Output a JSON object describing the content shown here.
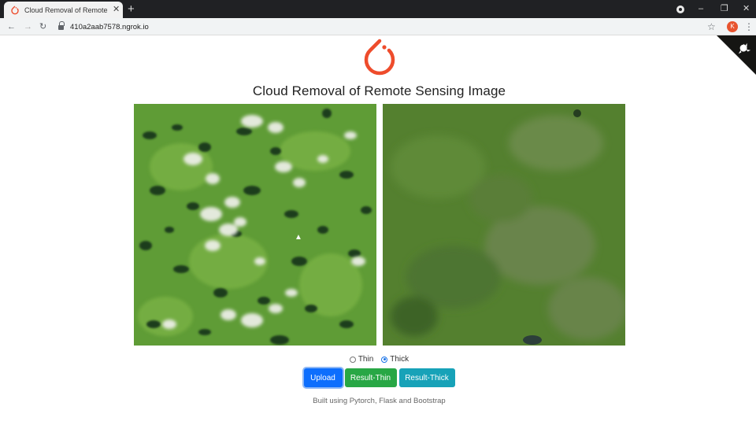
{
  "browser": {
    "tab_title": "Cloud Removal of Remote Se...",
    "tab_close_label": "✕",
    "new_tab_label": "+",
    "url": "410a2aab7578.ngrok.io",
    "profile_initial": "K",
    "nav": {
      "back": "←",
      "forward": "→",
      "reload": "↻"
    },
    "window": {
      "minimize": "–",
      "restore": "❐",
      "close": "✕"
    },
    "star_label": "☆",
    "menu_label": "⋮"
  },
  "page": {
    "title": "Cloud Removal of Remote Sensing Image",
    "icons": {
      "logo": "pytorch-logo-icon",
      "corner": "github-octocat-icon"
    },
    "images": {
      "input": "cloudy-satellite-image",
      "output": "cloud-free-satellite-image"
    },
    "mode": {
      "options": [
        {
          "label": "Thin",
          "selected": false
        },
        {
          "label": "Thick",
          "selected": true
        }
      ]
    },
    "buttons": {
      "upload": "Upload",
      "result_thin": "Result-Thin",
      "result_thick": "Result-Thick"
    },
    "footer": "Built using Pytorch, Flask and Bootstrap"
  },
  "colors": {
    "upload_button": "#0d6efd",
    "result_thin_button": "#28a745",
    "result_thick_button": "#17a2b8",
    "logo": "#ee4c2c",
    "terrain_green": "#5d9a34",
    "cloud": "#f2f2ee"
  }
}
